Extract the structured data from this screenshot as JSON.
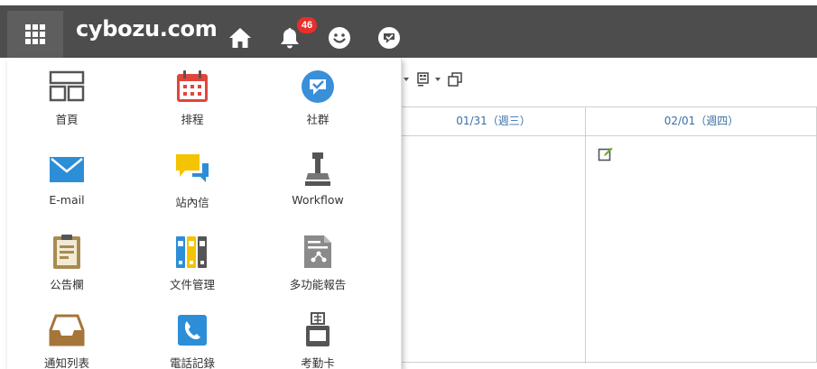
{
  "header": {
    "brand": "cybozu.com",
    "notification_count": "46"
  },
  "calendar": {
    "columns": [
      {
        "label": "01/31（週三）"
      },
      {
        "label": "02/01（週四）"
      }
    ]
  },
  "apps": [
    {
      "label": "首頁",
      "icon": "portal-icon"
    },
    {
      "label": "排程",
      "icon": "calendar-icon"
    },
    {
      "label": "社群",
      "icon": "community-icon"
    },
    {
      "label": "E-mail",
      "icon": "mail-icon"
    },
    {
      "label": "站內信",
      "icon": "message-icon"
    },
    {
      "label": "Workflow",
      "icon": "workflow-stamp-icon"
    },
    {
      "label": "公告欄",
      "icon": "bulletin-icon"
    },
    {
      "label": "文件管理",
      "icon": "cabinet-icon"
    },
    {
      "label": "多功能報告",
      "icon": "report-icon"
    },
    {
      "label": "通知列表",
      "icon": "inbox-icon"
    },
    {
      "label": "電話記錄",
      "icon": "phone-memo-icon"
    },
    {
      "label": "考勤卡",
      "icon": "timecard-icon"
    }
  ],
  "colors": {
    "header_bg": "#4d4d4d",
    "badge": "#e8302b",
    "accent_blue": "#3a8fd9",
    "calendar_red": "#e0463c",
    "mail_blue": "#2c8ed6",
    "message_yellow": "#f4c400"
  }
}
